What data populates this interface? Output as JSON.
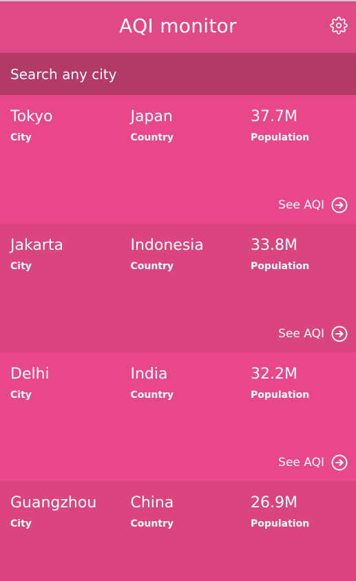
{
  "app": {
    "title": "AQI monitor",
    "settings_icon": "gear-icon"
  },
  "search": {
    "placeholder": "Search any city"
  },
  "labels": {
    "city": "City",
    "country": "Country",
    "population": "Population",
    "see_aqi": "See AQI"
  },
  "cities": [
    {
      "city": "Tokyo",
      "country": "Japan",
      "population": "37.7M"
    },
    {
      "city": "Jakarta",
      "country": "Indonesia",
      "population": "33.8M"
    },
    {
      "city": "Delhi",
      "country": "India",
      "population": "32.2M"
    },
    {
      "city": "Guangzhou",
      "country": "China",
      "population": "26.9M"
    }
  ],
  "colors": {
    "header": "#df4a86",
    "search_bar": "#b13a66",
    "card_light": "#e8478a",
    "card_dark": "#db457f",
    "text": "#ffffff"
  }
}
